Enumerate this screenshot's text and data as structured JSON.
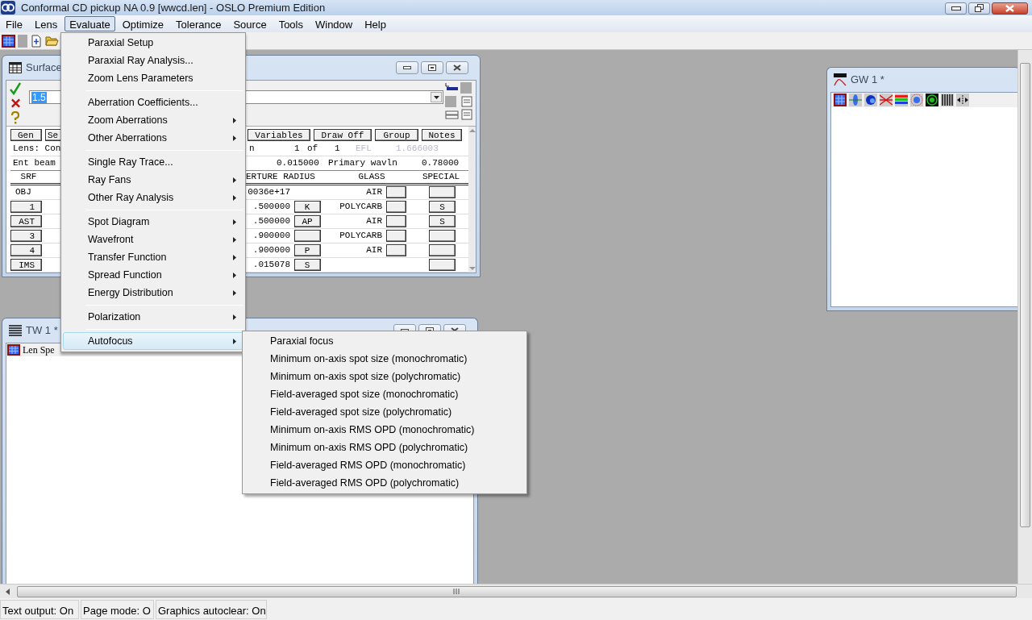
{
  "window": {
    "title": "Conformal CD pickup NA 0.9 [wwcd.len] - OSLO Premium Edition"
  },
  "menu_bar": [
    {
      "label": "File",
      "selected": false
    },
    {
      "label": "Lens",
      "selected": false
    },
    {
      "label": "Evaluate",
      "selected": true
    },
    {
      "label": "Optimize",
      "selected": false
    },
    {
      "label": "Tolerance",
      "selected": false
    },
    {
      "label": "Source",
      "selected": false
    },
    {
      "label": "Tools",
      "selected": false
    },
    {
      "label": "Window",
      "selected": false
    },
    {
      "label": "Help",
      "selected": false
    }
  ],
  "surface_window": {
    "title": "Surface",
    "input_value": "1.5",
    "left_buttons": [
      "Gen",
      "Se"
    ],
    "right_buttons": [
      "Variables",
      "Draw Off",
      "Group",
      "Notes"
    ],
    "lens_row": [
      "Lens: Con",
      "n",
      "1",
      "of",
      "1"
    ],
    "efl": {
      "label": "EFL",
      "value": "1.666003",
      "disabled": true
    },
    "beam_row": [
      "Ent beam",
      "0.015000",
      "Primary wavln",
      "0.78000"
    ],
    "columns": [
      "SRF",
      "ERTURE RADIUS",
      "GLASS",
      "SPECIAL"
    ],
    "rows": [
      {
        "srf": "OBJ",
        "srf_button": false,
        "aperture": "0036e+17",
        "aperture_button": false,
        "glass": "AIR",
        "glass_button": true,
        "special_button": true
      },
      {
        "srf": "1",
        "srf_button": true,
        "aperture": ".500000",
        "aperture_button": true,
        "aperture_flag": "K",
        "glass": "POLYCARB",
        "glass_button": true,
        "special_button": true,
        "special": "S"
      },
      {
        "srf": "AST",
        "srf_button": true,
        "aperture": ".500000",
        "aperture_button": true,
        "aperture_flag": "AP",
        "glass": "AIR",
        "glass_button": true,
        "special_button": true,
        "special": "S"
      },
      {
        "srf": "3",
        "srf_button": true,
        "aperture": ".900000",
        "aperture_button": true,
        "glass": "POLYCARB",
        "glass_button": true,
        "special_button": true
      },
      {
        "srf": "4",
        "srf_button": true,
        "aperture": ".900000",
        "aperture_button": true,
        "aperture_flag": "P",
        "glass": "AIR",
        "glass_button": true,
        "special_button": true
      },
      {
        "srf": "IMS",
        "srf_button": true,
        "aperture": ".015078",
        "aperture_button": true,
        "aperture_flag": "S",
        "glass_button": false,
        "special_button": true
      }
    ]
  },
  "text_window": {
    "title": "TW 1 *",
    "toolbar_label": "Len Spe"
  },
  "graphics_window": {
    "title": "GW 1 *"
  },
  "evaluate_menu": [
    {
      "kind": "item",
      "label": "Paraxial Setup",
      "submenu": false,
      "selected": false
    },
    {
      "kind": "item",
      "label": "Paraxial Ray Analysis...",
      "submenu": false,
      "selected": false
    },
    {
      "kind": "item",
      "label": "Zoom Lens Parameters",
      "submenu": false,
      "selected": false
    },
    {
      "kind": "separator"
    },
    {
      "kind": "item",
      "label": "Aberration Coefficients...",
      "submenu": false,
      "selected": false
    },
    {
      "kind": "item",
      "label": "Zoom Aberrations",
      "submenu": true,
      "selected": false
    },
    {
      "kind": "item",
      "label": "Other Aberrations",
      "submenu": true,
      "selected": false
    },
    {
      "kind": "separator"
    },
    {
      "kind": "item",
      "label": "Single Ray Trace...",
      "submenu": false,
      "selected": false
    },
    {
      "kind": "item",
      "label": "Ray Fans",
      "submenu": true,
      "selected": false
    },
    {
      "kind": "item",
      "label": "Other Ray Analysis",
      "submenu": true,
      "selected": false
    },
    {
      "kind": "separator"
    },
    {
      "kind": "item",
      "label": "Spot Diagram",
      "submenu": true,
      "selected": false
    },
    {
      "kind": "item",
      "label": "Wavefront",
      "submenu": true,
      "selected": false
    },
    {
      "kind": "item",
      "label": "Transfer Function",
      "submenu": true,
      "selected": false
    },
    {
      "kind": "item",
      "label": "Spread Function",
      "submenu": true,
      "selected": false
    },
    {
      "kind": "item",
      "label": "Energy Distribution",
      "submenu": true,
      "selected": false
    },
    {
      "kind": "separator"
    },
    {
      "kind": "item",
      "label": "Polarization",
      "submenu": true,
      "selected": false
    },
    {
      "kind": "separator"
    },
    {
      "kind": "item",
      "label": "Autofocus",
      "submenu": true,
      "selected": true
    }
  ],
  "autofocus_menu": [
    "Paraxial focus",
    "Minimum on-axis spot size (monochromatic)",
    "Minimum on-axis spot size (polychromatic)",
    "Field-averaged spot size (monochromatic)",
    "Field-averaged spot size (polychromatic)",
    "Minimum on-axis RMS OPD (monochromatic)",
    "Minimum on-axis RMS OPD (polychromatic)",
    "Field-averaged RMS OPD (monochromatic)",
    "Field-averaged RMS OPD (polychromatic)"
  ],
  "status_bar": [
    "Text output: On",
    "Page mode: O",
    "Graphics autoclear: On"
  ]
}
